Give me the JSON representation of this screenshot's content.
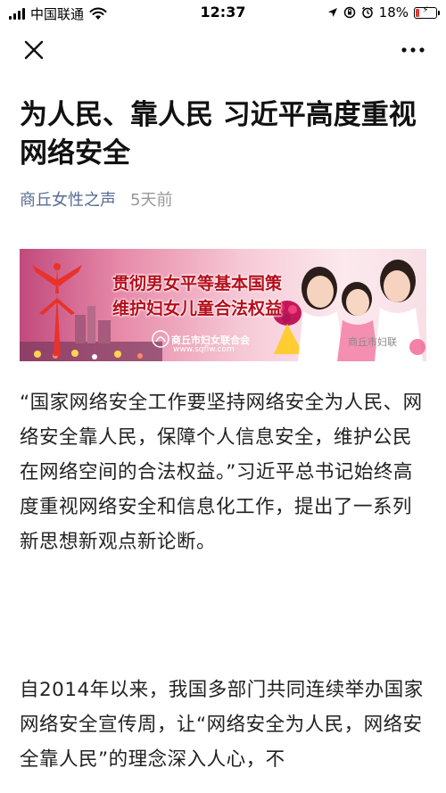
{
  "status_bar": {
    "carrier": "中国联通",
    "time": "12:37",
    "battery_percent": "18%",
    "battery_level": 0.18
  },
  "nav": {
    "close_icon": "close-icon",
    "more_icon": "more-icon"
  },
  "article": {
    "title": "为人民、靠人民 习近平高度重视网络安全",
    "author": "商丘女性之声",
    "time_ago": "5天前",
    "banner": {
      "line1": "贯彻男女平等基本国策",
      "line2": "维护妇女儿童合法权益",
      "org": "商丘市妇女联合会",
      "url": "www.sqflw.com",
      "watermark": "商丘市妇联"
    },
    "paragraphs": [
      "“国家网络安全工作要坚持网络安全为人民、网络安全靠人民，保障个人信息安全，维护公民在网络空间的合法权益。”习近平总书记始终高度重视网络安全和信息化工作，提出了一系列新思想新观点新论断。",
      "自2014年以来，我国多部门共同连续举办国家网络安全宣传周，让“网络安全为人民，网络安全靠人民”的理念深入人心，不"
    ]
  },
  "colors": {
    "link": "#576b95",
    "meta_gray": "#999999",
    "banner_text": "#b50d1a",
    "battery_low": "#e53935"
  }
}
